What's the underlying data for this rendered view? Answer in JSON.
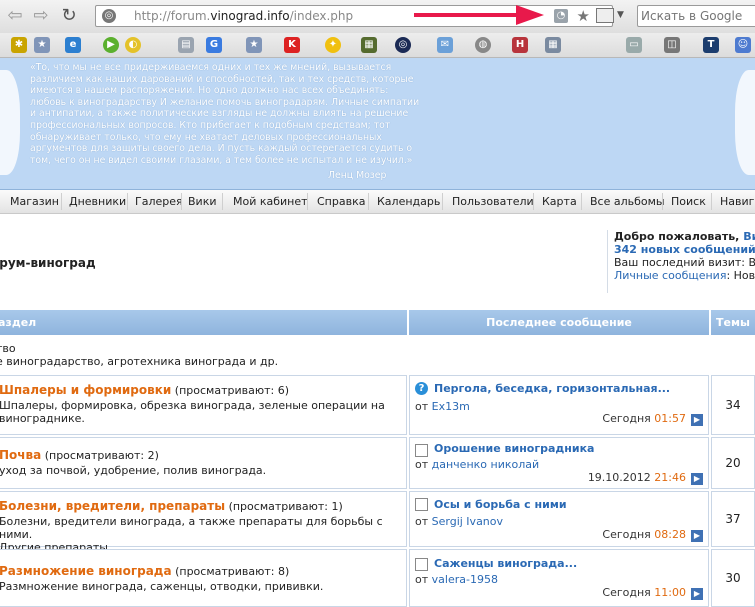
{
  "browser": {
    "url_host": "http://forum.",
    "url_domain": "vinograd.info",
    "url_path": "/index.php",
    "search_placeholder": "Искать в Google"
  },
  "banner": {
    "quote": "«То, что мы не все придерживаемся одних и тех же мнений, вызывается различием как наших дарований и способностей, так и тех средств, которые имеются в нашем распоряжении. Но одно должно нас всех объединять: любовь к виноградарству И желание помочь виноградарям. Личные симпатии и антипатии, а также политические взгляды не должны влиять на решение профессиональных вопросов. Кто прибегает к подобным средствам; тот обнаруживает только, что ему не хватает деловых профессиональных аргументов для защиты своего дела. И пусть каждый остерегается судить о том, чего он не видел своими глазами, а тем более не испытал и не изучил.»",
    "author": "Ленц Мозер"
  },
  "menu": [
    "Магазин",
    "Дневники",
    "Галерея",
    "Вики",
    "Мой кабинет",
    "Справка",
    "Календарь",
    "Пользователи",
    "Карта",
    "Все альбомы",
    "Поиск",
    "Навига"
  ],
  "header": {
    "title": "орум-виноград",
    "welcome_prefix": "Добро пожаловать,",
    "welcome_user": "Вит",
    "new_posts": "342 новых сообщений.",
    "last_visit": "Ваш последний визит: Вчера",
    "messages_link": "Личные сообщения",
    "messages_suffix": ": Новых С"
  },
  "table": {
    "col_section": "аздел",
    "col_last": "Последнее сообщение",
    "col_topics": "Темы",
    "category_title": "тво",
    "category_desc": "е виноградарство, агротехника винограда и др.",
    "rows": [
      {
        "name": "Шпалеры и формировки",
        "viewing": "(просматривают: 6)",
        "desc1": "Шпалеры, формировка, обрезка винограда, зеленые операции на",
        "desc2": "винограднике.",
        "last_title": "Пергола, беседка, горизонтальная...",
        "from": "от",
        "user": "Ex13m",
        "date": "Сегодня",
        "time": "01:57",
        "topics": "34"
      },
      {
        "name": "Почва",
        "viewing": "(просматривают: 2)",
        "desc1": "уход за почвой, удобрение, полив винограда.",
        "desc2": "",
        "last_title": "Орошение виноградника",
        "from": "от",
        "user": "данченко николай",
        "date": "19.10.2012",
        "time": "21:46",
        "topics": "20"
      },
      {
        "name": "Болезни, вредители, препараты",
        "viewing": "(просматривают: 1)",
        "desc1": "Болезни, вредители винограда, а также препараты для борьбы с ними.",
        "desc2": "Другие препараты.",
        "last_title": "Осы и борьба с ними",
        "from": "от",
        "user": "Sergij Ivanov",
        "date": "Сегодня",
        "time": "08:28",
        "topics": "37"
      },
      {
        "name": "Размножение винограда",
        "viewing": "(просматривают: 8)",
        "desc1": "Размножение винограда, саженцы, отводки, прививки.",
        "desc2": "",
        "last_title": "Саженцы винограда...",
        "from": "от",
        "user": "valera-1958",
        "date": "Сегодня",
        "time": "11:00",
        "topics": "30"
      }
    ]
  }
}
